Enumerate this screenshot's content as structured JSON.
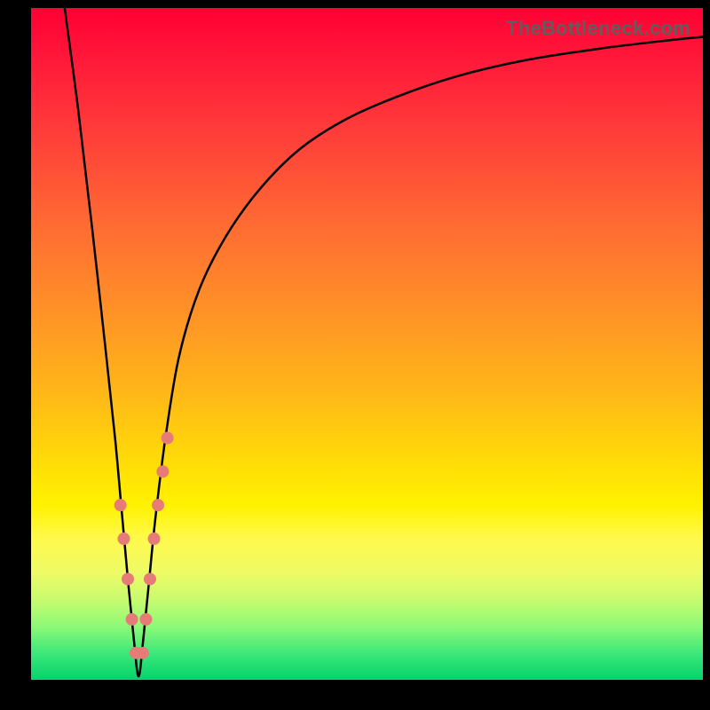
{
  "watermark": "TheBottleneck.com",
  "chart_data": {
    "type": "line",
    "title": "",
    "xlabel": "",
    "ylabel": "",
    "xlim": [
      0,
      100
    ],
    "ylim": [
      0,
      100
    ],
    "grid": false,
    "series": [
      {
        "name": "bottleneck-curve",
        "x": [
          5,
          7,
          9,
          11,
          12.5,
          13.5,
          14.5,
          15.3,
          16,
          16.7,
          17.5,
          18.5,
          20,
          22,
          25,
          29,
          34,
          40,
          47,
          55,
          64,
          74,
          85,
          95,
          100
        ],
        "y": [
          100,
          85,
          68,
          50,
          36,
          25,
          14,
          6,
          0.5,
          6,
          14,
          24,
          36,
          48,
          58,
          66,
          73,
          79,
          83.5,
          87,
          90,
          92.3,
          94,
          95.2,
          95.7
        ]
      }
    ],
    "markers": {
      "name": "highlight-points",
      "x": [
        13.3,
        13.8,
        14.4,
        15.0,
        15.6,
        16.6,
        17.1,
        17.7,
        18.3,
        18.9,
        19.6,
        20.3
      ],
      "y": [
        26,
        21,
        15,
        9,
        4,
        4,
        9,
        15,
        21,
        26,
        31,
        36
      ]
    },
    "background_gradient": {
      "top": "#ff0033",
      "mid": "#fff200",
      "bottom": "#04d36c"
    }
  }
}
